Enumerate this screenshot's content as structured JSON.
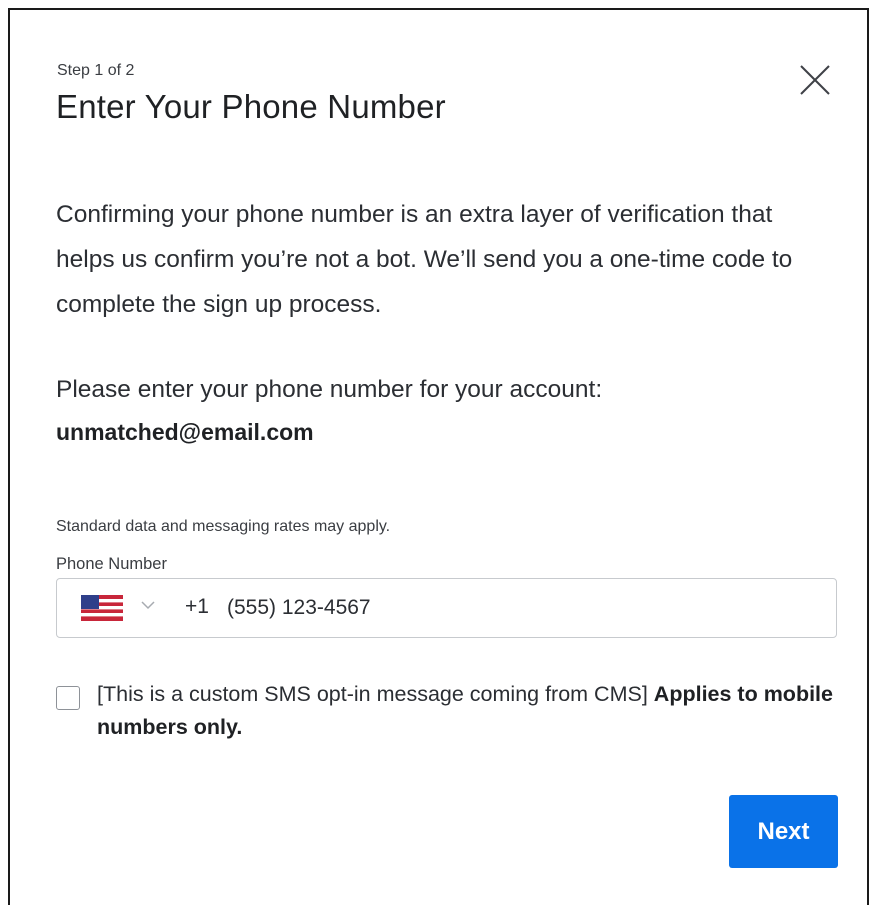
{
  "dialog": {
    "step": "Step 1 of 2",
    "title": "Enter Your Phone Number",
    "close_icon": "close-icon"
  },
  "intro": {
    "text": "Confirming your phone number is an extra layer of verification that helps us confirm you’re not a bot. We’ll send you a one-time code to complete the sign up process."
  },
  "account": {
    "prompt": "Please enter your phone number for your account:",
    "email": "unmatched@email.com"
  },
  "phone": {
    "disclaimer": "Standard data and messaging rates may apply.",
    "label": "Phone Number",
    "country_flag_icon": "us-flag-icon",
    "country_dropdown_icon": "chevron-down-icon",
    "dial_code": "+1",
    "value": "(555) 123-4567"
  },
  "optin": {
    "checked": false,
    "message": "[This is a custom SMS opt-in message coming from CMS]",
    "emphasis": "Applies to mobile numbers only."
  },
  "actions": {
    "next_label": "Next"
  },
  "colors": {
    "primary_button": "#0a72e8",
    "text": "#2b2e33",
    "border": "#c7cace"
  }
}
